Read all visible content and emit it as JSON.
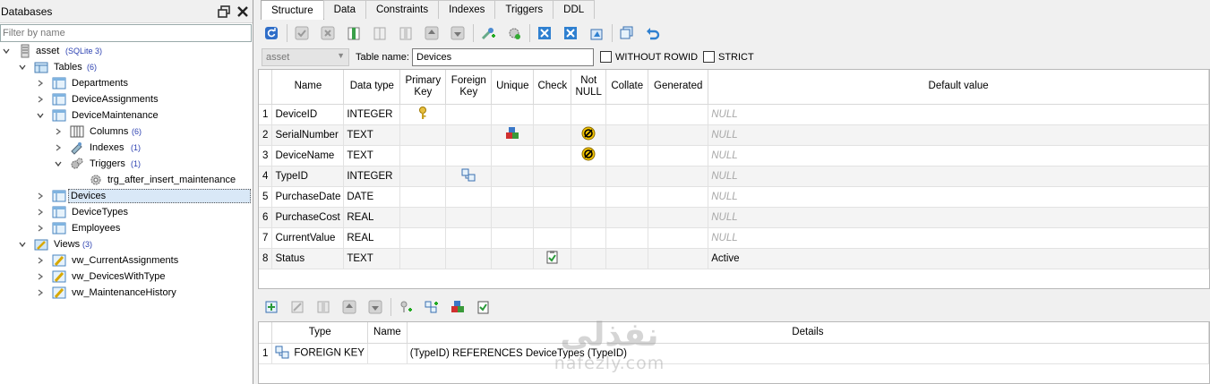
{
  "left_panel": {
    "title": "Databases",
    "filter_placeholder": "Filter by name",
    "tree": {
      "db_name": "asset",
      "db_type": "(SQLite 3)",
      "tables_label": "Tables",
      "tables_count": "(6)",
      "tables": [
        "Departments",
        "DeviceAssignments",
        "DeviceMaintenance",
        "Devices",
        "DeviceTypes",
        "Employees"
      ],
      "maint_children": {
        "columns_label": "Columns",
        "columns_count": "(6)",
        "indexes_label": "Indexes",
        "indexes_count": "(1)",
        "triggers_label": "Triggers",
        "triggers_count": "(1)",
        "trigger_name": "trg_after_insert_maintenance"
      },
      "views_label": "Views",
      "views_count": "(3)",
      "views": [
        "vw_CurrentAssignments",
        "vw_DevicesWithType",
        "vw_MaintenanceHistory"
      ],
      "selected": "Devices"
    }
  },
  "tabs": [
    "Structure",
    "Data",
    "Constraints",
    "Indexes",
    "Triggers",
    "DDL"
  ],
  "active_tab": "Structure",
  "form": {
    "database": "asset",
    "table_name_label": "Table name:",
    "table_name": "Devices",
    "without_rowid_label": "WITHOUT ROWID",
    "strict_label": "STRICT"
  },
  "columns_grid": {
    "headers": [
      "Name",
      "Data type",
      "Primary Key",
      "Foreign Key",
      "Unique",
      "Check",
      "Not NULL",
      "Collate",
      "Generated",
      "Default value"
    ],
    "rows": [
      {
        "n": "1",
        "name": "DeviceID",
        "type": "INTEGER",
        "pk": true,
        "fk": false,
        "unique": false,
        "check": false,
        "notnull": false,
        "default": "NULL"
      },
      {
        "n": "2",
        "name": "SerialNumber",
        "type": "TEXT",
        "pk": false,
        "fk": false,
        "unique": true,
        "check": false,
        "notnull": true,
        "default": "NULL"
      },
      {
        "n": "3",
        "name": "DeviceName",
        "type": "TEXT",
        "pk": false,
        "fk": false,
        "unique": false,
        "check": false,
        "notnull": true,
        "default": "NULL"
      },
      {
        "n": "4",
        "name": "TypeID",
        "type": "INTEGER",
        "pk": false,
        "fk": true,
        "unique": false,
        "check": false,
        "notnull": false,
        "default": "NULL"
      },
      {
        "n": "5",
        "name": "PurchaseDate",
        "type": "DATE",
        "pk": false,
        "fk": false,
        "unique": false,
        "check": false,
        "notnull": false,
        "default": "NULL"
      },
      {
        "n": "6",
        "name": "PurchaseCost",
        "type": "REAL",
        "pk": false,
        "fk": false,
        "unique": false,
        "check": false,
        "notnull": false,
        "default": "NULL"
      },
      {
        "n": "7",
        "name": "CurrentValue",
        "type": "REAL",
        "pk": false,
        "fk": false,
        "unique": false,
        "check": false,
        "notnull": false,
        "default": "NULL"
      },
      {
        "n": "8",
        "name": "Status",
        "type": "TEXT",
        "pk": false,
        "fk": false,
        "unique": false,
        "check": true,
        "notnull": false,
        "default": "Active"
      }
    ]
  },
  "constraints_grid": {
    "headers": [
      "Type",
      "Name",
      "Details"
    ],
    "rows": [
      {
        "n": "1",
        "type": "FOREIGN KEY",
        "name": "",
        "details": "(TypeID) REFERENCES DeviceTypes (TypeID)"
      }
    ]
  },
  "watermark": {
    "arabic": "نفذلي",
    "latin": "nafezly.com"
  },
  "colors": {
    "null_text": "#a8a8a8",
    "selection": "#d9e8f7",
    "count_blue": "#2a3fb0"
  }
}
